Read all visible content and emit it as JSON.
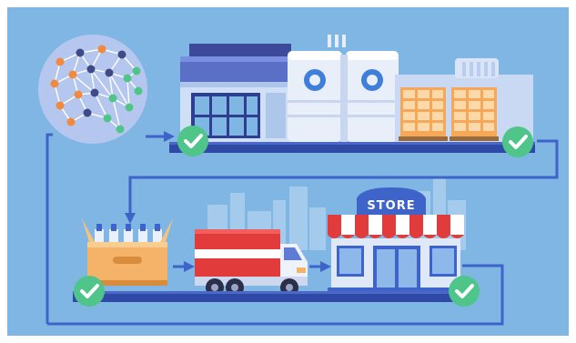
{
  "scene": {
    "store_sign": "STORE",
    "stages": [
      {
        "id": "ai-brain",
        "icon": "neural-network-brain-icon"
      },
      {
        "id": "factory",
        "icon": "factory-icon",
        "status": "check"
      },
      {
        "id": "warehouse",
        "icon": "warehouse-pallets-icon",
        "status": "check"
      },
      {
        "id": "packaging",
        "icon": "bottle-crate-icon",
        "status": "check"
      },
      {
        "id": "delivery",
        "icon": "delivery-truck-icon"
      },
      {
        "id": "retail",
        "icon": "store-icon",
        "status": "check"
      }
    ]
  },
  "colors": {
    "background": "#7fb6e3",
    "frame": "#ffffff",
    "flow_line": "#3e63c9",
    "check_badge": "#4fc58a",
    "truck_red": "#e23b3b",
    "awning_red": "#e23b3b",
    "crate_orange": "#f5b36a"
  }
}
